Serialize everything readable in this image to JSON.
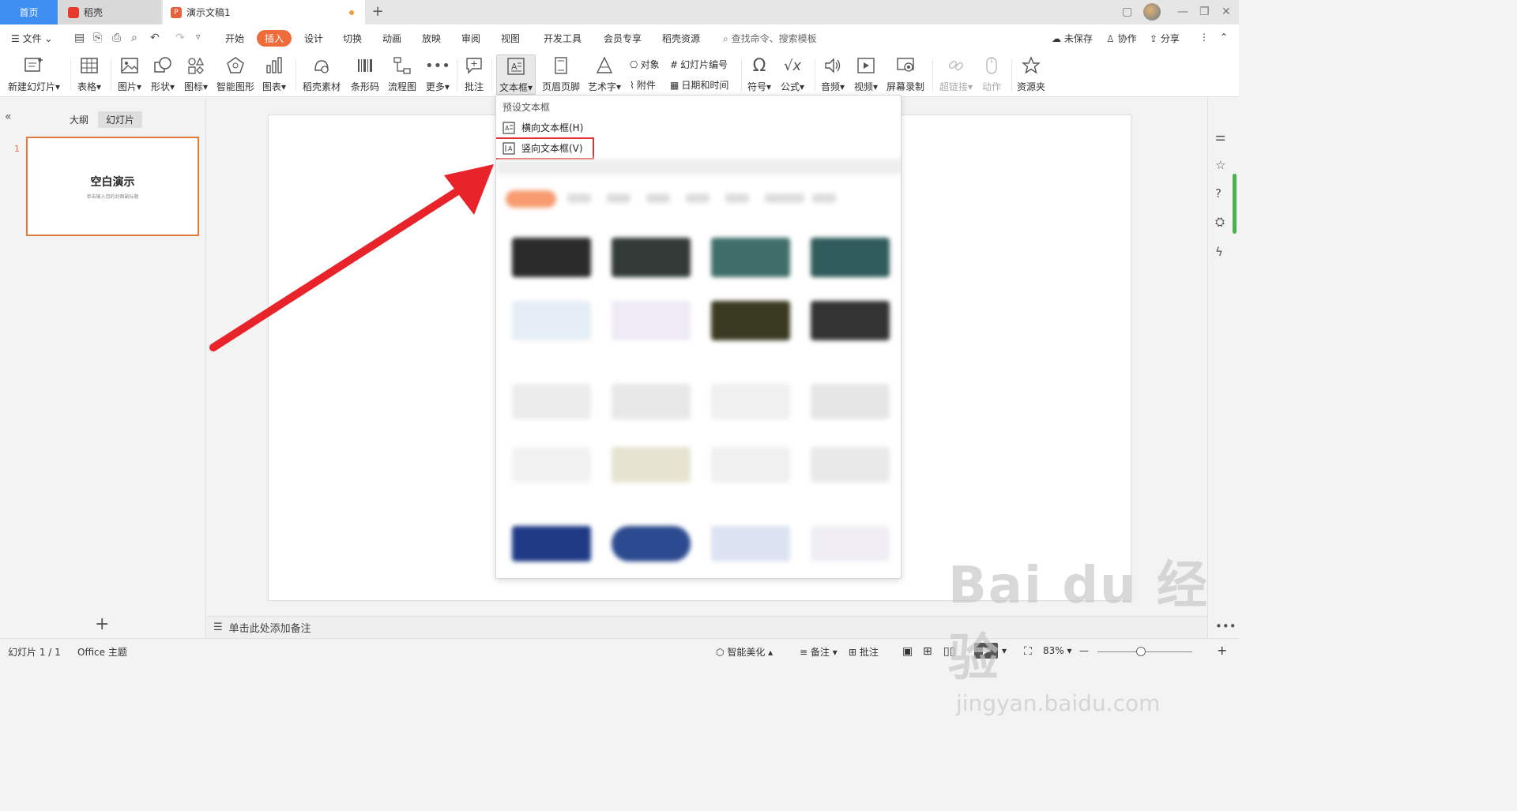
{
  "tabs": {
    "home": "首页",
    "daoke": "稻壳",
    "document": "演示文稿1"
  },
  "menu": {
    "file": "文件",
    "items": [
      "开始",
      "插入",
      "设计",
      "切换",
      "动画",
      "放映",
      "审阅",
      "视图",
      "开发工具",
      "会员专享",
      "稻壳资源"
    ],
    "search_placeholder": "查找命令、搜索模板",
    "unsaved": "未保存",
    "collaborate": "协作",
    "share": "分享"
  },
  "ribbon": {
    "new_slide": "新建幻灯片",
    "table": "表格",
    "picture": "图片",
    "shape": "形状",
    "icon": "图标",
    "smart_art": "智能图形",
    "chart": "图表",
    "daoke_material": "稻壳素材",
    "barcode": "条形码",
    "flowchart": "流程图",
    "more": "更多",
    "comment": "批注",
    "textbox": "文本框",
    "header_footer": "页眉页脚",
    "art_text": "艺术字",
    "object": "对象",
    "attachment": "附件",
    "slide_number": "幻灯片编号",
    "date_time": "日期和时间",
    "symbol": "符号",
    "formula": "公式",
    "audio": "音频",
    "video": "视频",
    "screen_record": "屏幕录制",
    "hyperlink": "超链接",
    "action": "动作",
    "resource_folder": "资源夹"
  },
  "left_panel": {
    "outline_tab": "大纲",
    "slides_tab": "幻灯片",
    "slide_number": "1",
    "thumb_title": "空白演示",
    "thumb_subtitle": "单击输入您的封面副标题"
  },
  "notes_placeholder": "单击此处添加备注",
  "dropdown": {
    "header": "预设文本框",
    "horizontal": "横向文本框(H)",
    "vertical": "竖向文本框(V)"
  },
  "status": {
    "slide_count": "幻灯片 1 / 1",
    "theme": "Office 主题",
    "smart_beautify": "智能美化",
    "notes": "备注",
    "comments": "批注",
    "zoom": "83%"
  },
  "colors": {
    "accent": "#f06b3a",
    "tab_home": "#3d8ef0",
    "highlight_box": "#e23030",
    "arrow": "#e8232a"
  }
}
